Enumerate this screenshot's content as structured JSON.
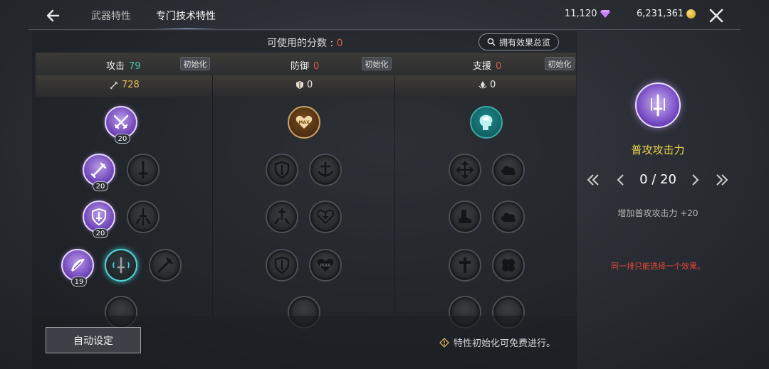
{
  "header": {
    "tabs": [
      {
        "label": "武器特性",
        "active": false
      },
      {
        "label": "专门技术特性",
        "active": true
      }
    ],
    "currency": {
      "gems": "11,120",
      "gold": "6,231,361"
    }
  },
  "panel": {
    "points_label": "可使用的分数 :",
    "points_value": "0",
    "summary_button": "拥有效果总览",
    "columns": [
      {
        "title": "攻击",
        "count": "79",
        "count_color": "#45c4b0",
        "reset": "初始化",
        "stat": "728",
        "stat_color": "#f0b85a"
      },
      {
        "title": "防御",
        "count": "0",
        "count_color": "#e05a4a",
        "reset": "初始化",
        "stat": "0",
        "stat_color": "#e6e6e6"
      },
      {
        "title": "支援",
        "count": "0",
        "count_color": "#e05a4a",
        "reset": "初始化",
        "stat": "0",
        "stat_color": "#e6e6e6"
      }
    ],
    "levels": {
      "attack_top": "20",
      "attack_r2": "20",
      "attack_r3": "20",
      "attack_r4": "19"
    },
    "max_label": "MAX"
  },
  "footer": {
    "auto_button": "自动设定",
    "free_note": "特性初始化可免费进行。"
  },
  "detail": {
    "name": "普攻攻击力",
    "level": "0 / 20",
    "effect": "增加普攻攻击力 +20",
    "warning": "同一排只能选择一个效果。"
  }
}
